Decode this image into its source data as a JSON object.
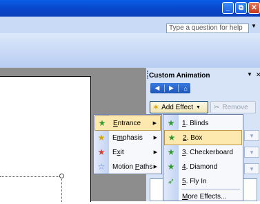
{
  "window": {
    "controls": [
      {
        "name": "minimize",
        "glyph": "_"
      },
      {
        "name": "restore",
        "glyph": "⧉"
      },
      {
        "name": "close",
        "glyph": "✕"
      }
    ]
  },
  "help": {
    "placeholder": "Type a question for help"
  },
  "task_pane": {
    "title": "Custom Animation",
    "menu_glyph": "▼",
    "close_glyph": "✕",
    "nav": {
      "back": "◀",
      "forward": "▶",
      "home": "⌂"
    },
    "add_effect": {
      "label": "Add Effect",
      "arrow": "▼"
    },
    "remove": {
      "label": "Remove"
    }
  },
  "effect_menu": {
    "items": [
      {
        "label": "Entrance",
        "accel": "E",
        "rest": "ntrance",
        "icon_color": "#2c9a2c"
      },
      {
        "label": "Emphasis",
        "accel": "m",
        "pre": "E",
        "rest": "phasis",
        "icon_color": "#d9a300"
      },
      {
        "label": "Exit",
        "accel": "x",
        "pre": "E",
        "rest": "it",
        "icon_color": "#d83a2a"
      },
      {
        "label": "Motion Paths",
        "accel": "P",
        "pre": "Motion ",
        "rest": "aths",
        "icon_color": "#5b7fcf"
      }
    ]
  },
  "entrance_menu": {
    "items": [
      {
        "label": "1. Blinds",
        "accel": "1",
        "rest": ". Blinds"
      },
      {
        "label": "2. Box",
        "accel": "2",
        "rest": ". Box"
      },
      {
        "label": "3. Checkerboard",
        "accel": "3",
        "rest": ". Checkerboard"
      },
      {
        "label": "4. Diamond",
        "accel": "4",
        "rest": ". Diamond"
      },
      {
        "label": "5. Fly In",
        "accel": "5",
        "rest": ". Fly In"
      }
    ],
    "more": {
      "label": "More Effects...",
      "accel": "M",
      "rest": "ore Effects..."
    }
  },
  "colors": {
    "title_bar": "#0a5de6",
    "highlight": "#fde8ad",
    "pane_bg": "#d7e4f7"
  }
}
